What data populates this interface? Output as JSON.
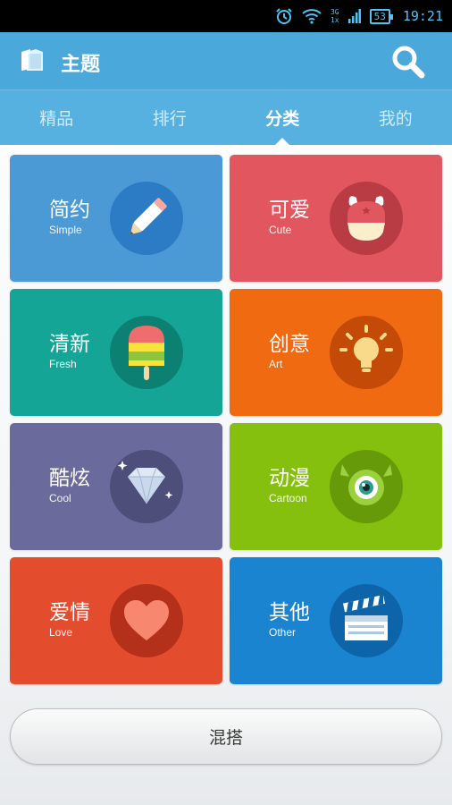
{
  "status_bar": {
    "network_top": "3G",
    "network_bottom": "1x",
    "battery": "53",
    "time": "19:21",
    "icons": [
      "alarm-icon",
      "wifi-icon",
      "signal-icon",
      "battery-icon"
    ]
  },
  "header": {
    "title": "主题",
    "logo_icon": "theme-book-icon",
    "search_icon": "search-icon",
    "color": "#4aa8da"
  },
  "tabs": [
    {
      "label": "精品",
      "active": false
    },
    {
      "label": "排行",
      "active": false
    },
    {
      "label": "分类",
      "active": true
    },
    {
      "label": "我的",
      "active": false
    }
  ],
  "categories": [
    {
      "name": "简约",
      "sub": "Simple",
      "color": "#4c9ad5",
      "circle": "#2b7cc4",
      "icon": "pencil-icon"
    },
    {
      "name": "可爱",
      "sub": "Cute",
      "color": "#e2575f",
      "circle": "#b93c44",
      "icon": "bunny-icon"
    },
    {
      "name": "清新",
      "sub": "Fresh",
      "color": "#14a597",
      "circle": "#0d8074",
      "icon": "popsicle-icon"
    },
    {
      "name": "创意",
      "sub": "Art",
      "color": "#ef6a10",
      "circle": "#c44a08",
      "icon": "lightbulb-icon"
    },
    {
      "name": "酷炫",
      "sub": "Cool",
      "color": "#6a6a9c",
      "circle": "#4e4e7a",
      "icon": "diamond-icon"
    },
    {
      "name": "动漫",
      "sub": "Cartoon",
      "color": "#86c00e",
      "circle": "#669a08",
      "icon": "monster-eye-icon"
    },
    {
      "name": "爱情",
      "sub": "Love",
      "color": "#e44c2e",
      "circle": "#b5301b",
      "icon": "heart-icon"
    },
    {
      "name": "其他",
      "sub": "Other",
      "color": "#1a84d0",
      "circle": "#0e64a8",
      "icon": "clapperboard-icon"
    }
  ],
  "bottom_button": {
    "label": "混搭"
  }
}
